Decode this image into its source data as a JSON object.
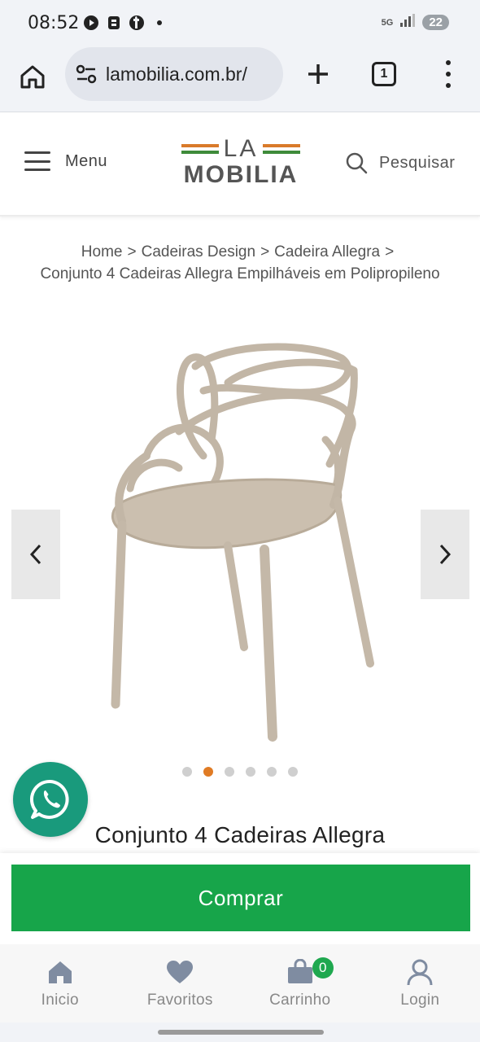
{
  "status_bar": {
    "time": "08:52",
    "network": "5G",
    "battery": "22"
  },
  "browser": {
    "url": "lamobilia.com.br/",
    "tab_count": "1"
  },
  "header": {
    "menu_label": "Menu",
    "logo_top": "LA",
    "logo_bottom": "MOBILIA",
    "search_label": "Pesquisar"
  },
  "breadcrumb": {
    "home": "Home",
    "sep": ">",
    "category": "Cadeiras Design",
    "subcategory": "Cadeira Allegra",
    "current": "Conjunto 4 Cadeiras Allegra Empilháveis em Polipropileno"
  },
  "carousel": {
    "total_slides": 6,
    "active_slide": 2,
    "image_alt": "chair-image"
  },
  "product": {
    "title": "Conjunto 4 Cadeiras Allegra"
  },
  "buy": {
    "label": "Comprar"
  },
  "bottom_nav": {
    "home": "Inicio",
    "favorites": "Favoritos",
    "cart": "Carrinho",
    "cart_count": "0",
    "login": "Login"
  },
  "colors": {
    "accent_green": "#17a54a",
    "logo_orange": "#d97a2a",
    "whatsapp": "#199a7c",
    "active_dot": "#e07b24"
  }
}
